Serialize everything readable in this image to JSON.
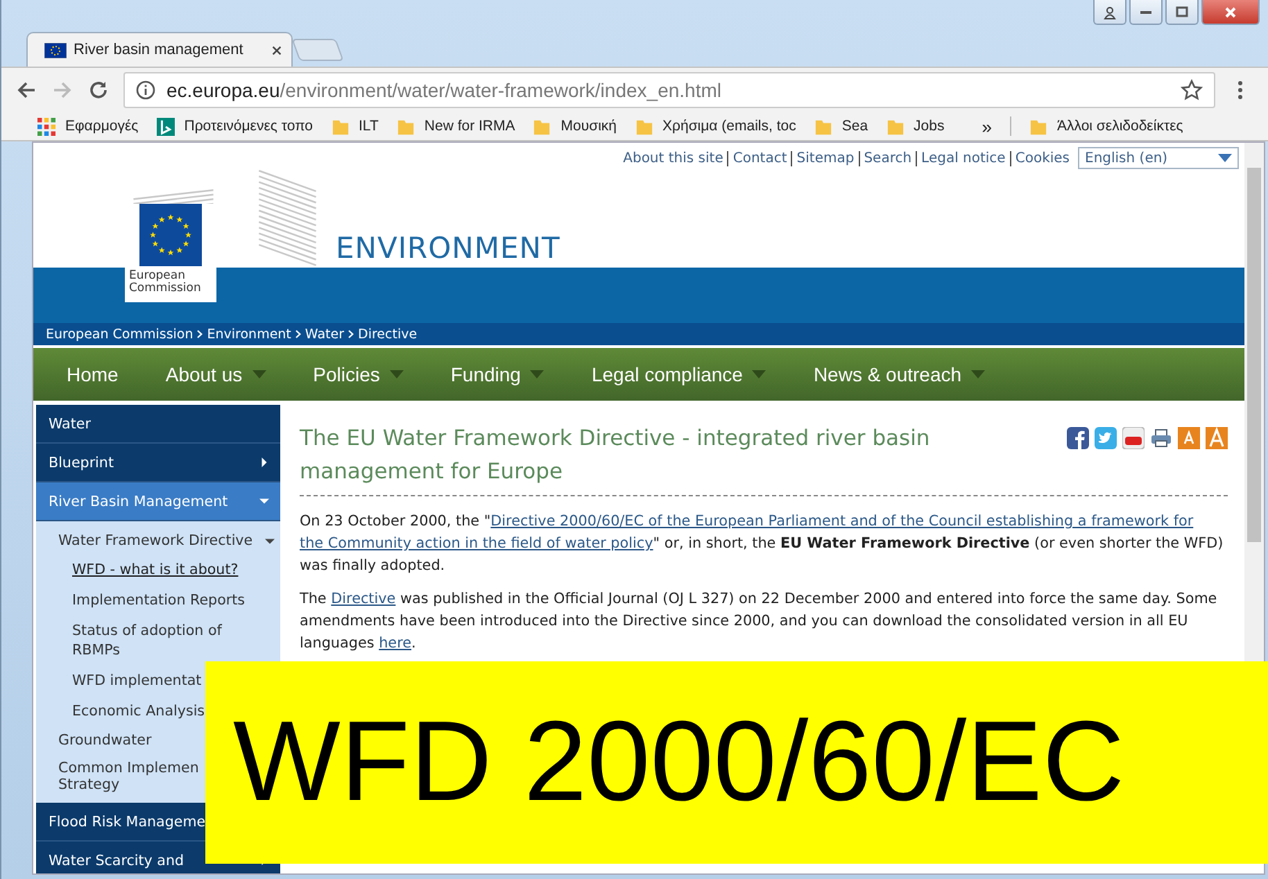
{
  "browser": {
    "tab_title": "River basin management",
    "url_host": "ec.europa.eu",
    "url_path": "/environment/water/water-framework/index_en.html",
    "bookmarks": [
      {
        "label": "Εφαρμογές",
        "kind": "apps"
      },
      {
        "label": "Προτεινόμενες τοπο",
        "kind": "site"
      },
      {
        "label": "ILT",
        "kind": "folder"
      },
      {
        "label": "New for IRMA",
        "kind": "folder"
      },
      {
        "label": "Μουσική",
        "kind": "folder"
      },
      {
        "label": "Χρήσιμα (emails, toc",
        "kind": "folder"
      },
      {
        "label": "Sea",
        "kind": "folder"
      },
      {
        "label": "Jobs",
        "kind": "folder"
      }
    ],
    "overflow": "»",
    "other_bookmarks": "Άλλοι σελιδοδείκτες"
  },
  "page": {
    "top_links": [
      "About this site",
      "Contact",
      "Sitemap",
      "Search",
      "Legal notice",
      "Cookies"
    ],
    "language": "English (en)",
    "logo_lines": [
      "European",
      "Commission"
    ],
    "site_title": "ENVIRONMENT",
    "breadcrumb": [
      "European Commission",
      "Environment",
      "Water",
      "Directive"
    ],
    "nav": [
      {
        "label": "Home",
        "dropdown": false
      },
      {
        "label": "About us",
        "dropdown": true
      },
      {
        "label": "Policies",
        "dropdown": true
      },
      {
        "label": "Funding",
        "dropdown": true
      },
      {
        "label": "Legal compliance",
        "dropdown": true
      },
      {
        "label": "News & outreach",
        "dropdown": true
      }
    ],
    "sidebar": [
      {
        "label": "Water",
        "selected": false
      },
      {
        "label": "Blueprint",
        "selected": false,
        "expanded": false
      },
      {
        "label": "River Basin Management",
        "selected": true,
        "expanded": true,
        "children": [
          {
            "label": "Water Framework Directive",
            "expanded": true,
            "selected": false,
            "children": [
              {
                "label": "WFD - what is it about?",
                "selected": true
              },
              {
                "label": "Implementation Reports",
                "selected": false
              },
              {
                "lines": [
                  "Status of adoption of",
                  "RBMPs"
                ],
                "selected": false
              },
              {
                "label": "WFD implementat",
                "selected": false
              },
              {
                "label": "Economic Analysis",
                "selected": false
              }
            ]
          },
          {
            "label": "Groundwater",
            "selected": false
          },
          {
            "lines": [
              "Common Implemen",
              "Strategy"
            ],
            "selected": false
          }
        ]
      },
      {
        "label": "Flood Risk Manageme",
        "selected": false
      },
      {
        "label": "Water Scarcity and",
        "selected": false,
        "expanded": false
      }
    ],
    "article": {
      "title": "The EU Water Framework Directive - integrated river basin management for Europe",
      "paragraphs": [
        [
          {
            "kind": "text",
            "text": "On 23 October 2000, the \""
          },
          {
            "kind": "link",
            "text": "Directive 2000/60/EC of the European Parliament and of the Council establishing a framework for"
          },
          {
            "kind": "link",
            "text": "the Community action in the field of water policy"
          },
          {
            "kind": "text",
            "text": "\" or, in short, the "
          },
          {
            "kind": "bold",
            "text": "EU Water Framework Directive"
          },
          {
            "kind": "text",
            "text": " (or even shorter the WFD) was finally adopted."
          }
        ],
        [
          {
            "kind": "text",
            "text": "The "
          },
          {
            "kind": "link",
            "text": "Directive"
          },
          {
            "kind": "text",
            "text": " was published in the Official Journal (OJ L 327) on 22 December 2000 and entered into force the same day. Some amendments have been introduced into the Directive since 2000, and you can download the consolidated version in all EU languages "
          },
          {
            "kind": "link",
            "text": "here"
          },
          {
            "kind": "text",
            "text": "."
          }
        ]
      ]
    }
  },
  "banner": {
    "text": "WFD 2000/60/EC"
  }
}
